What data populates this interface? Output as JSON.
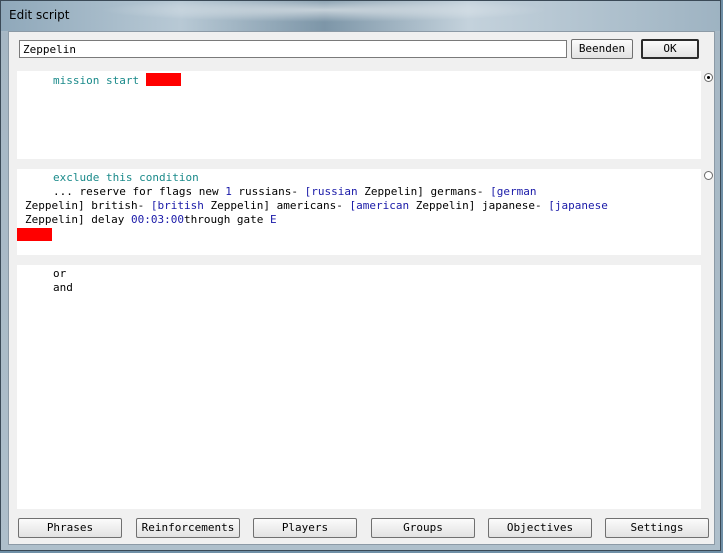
{
  "window": {
    "title": "Edit script"
  },
  "header": {
    "name_value": "Zeppelin",
    "beenden_label": "Beenden",
    "ok_label": "OK"
  },
  "condition1": {
    "keyword": "mission start",
    "selected": true
  },
  "condition2": {
    "keyword": "exclude this condition",
    "t1": "... reserve for flags new ",
    "n1": "1",
    "t2": " russians- ",
    "b1": "[russian",
    "t3": " Zeppelin] germans- ",
    "b2": "[german",
    "t4": "Zeppelin] british- ",
    "b3": "[british",
    "t5": " Zeppelin] americans- ",
    "b4": "[american",
    "t6": " Zeppelin] japanese- ",
    "b5": "[japanese",
    "t7": "Zeppelin] delay ",
    "time": "00:03:00",
    "t8": "through gate ",
    "gate": "E",
    "selected": false
  },
  "operators": {
    "or_label": "or",
    "and_label": "and"
  },
  "bottom_buttons": [
    "Phrases",
    "Reinforcements",
    "Players",
    "Groups",
    "Objectives",
    "Settings"
  ],
  "colors": {
    "keyword": "#1a8a8a",
    "value": "#1a1aa8",
    "placeholder": "#ff0000"
  }
}
